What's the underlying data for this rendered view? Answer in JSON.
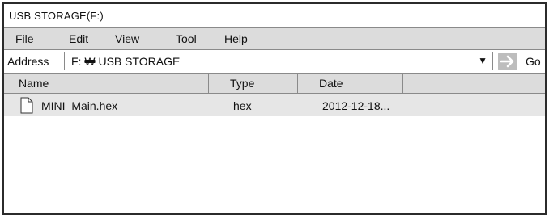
{
  "window": {
    "title": "USB STORAGE(F:)"
  },
  "menu": {
    "items": [
      "File",
      "Edit",
      "View",
      "Tool",
      "Help"
    ]
  },
  "address": {
    "label": "Address",
    "drive": "F:",
    "separator": "₩",
    "folder": "USB STORAGE",
    "dropdown_icon": "triangle-down-icon",
    "go_icon": "arrow-right-icon",
    "go_label": "Go"
  },
  "columns": {
    "name": "Name",
    "type": "Type",
    "date": "Date"
  },
  "files": [
    {
      "icon": "document-icon",
      "name": "MINI_Main.hex",
      "type": "hex",
      "date": "2012-12-18..."
    }
  ],
  "colors": {
    "bar_gray": "#dcdcdc",
    "row_selected": "#e6e6e6",
    "border": "#2b2b2b"
  }
}
